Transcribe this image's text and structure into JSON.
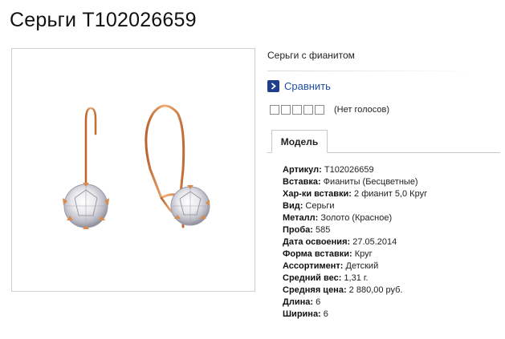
{
  "product": {
    "title": "Серьги Т102026659",
    "subtitle": "Серьги с фианитом",
    "image_alt": "earrings-image"
  },
  "compare": {
    "label": "Сравнить",
    "icon": "chevron-right-icon"
  },
  "rating": {
    "stars_total": 5,
    "stars_filled": 0,
    "votes_label": "(Нет голосов)"
  },
  "tabs": [
    {
      "label": "Модель",
      "active": true
    }
  ],
  "specs": [
    {
      "label": "Артикул:",
      "value": " Т102026659"
    },
    {
      "label": "Вставка:",
      "value": " Фианиты (Бесцветные)"
    },
    {
      "label": "Хар-ки вставки:",
      "value": " 2 фианит 5,0 Круг"
    },
    {
      "label": "Вид:",
      "value": " Серьги"
    },
    {
      "label": "Металл:",
      "value": " Золото (Красное)"
    },
    {
      "label": "Проба:",
      "value": " 585"
    },
    {
      "label": "Дата освоения:",
      "value": " 27.05.2014"
    },
    {
      "label": "Форма вставки:",
      "value": " Круг"
    },
    {
      "label": "Ассортимент:",
      "value": " Детский"
    },
    {
      "label": "Средний вес:",
      "value": " 1,31 г."
    },
    {
      "label": "Средняя цена:",
      "value": " 2 880,00 руб."
    },
    {
      "label": "Длина:",
      "value": " 6"
    },
    {
      "label": "Ширина:",
      "value": " 6"
    }
  ],
  "colors": {
    "link": "#1f4fa3",
    "compare_icon_bg": "#1f3f8e",
    "gold": "#d98a4e",
    "border": "#c7c7c7"
  }
}
